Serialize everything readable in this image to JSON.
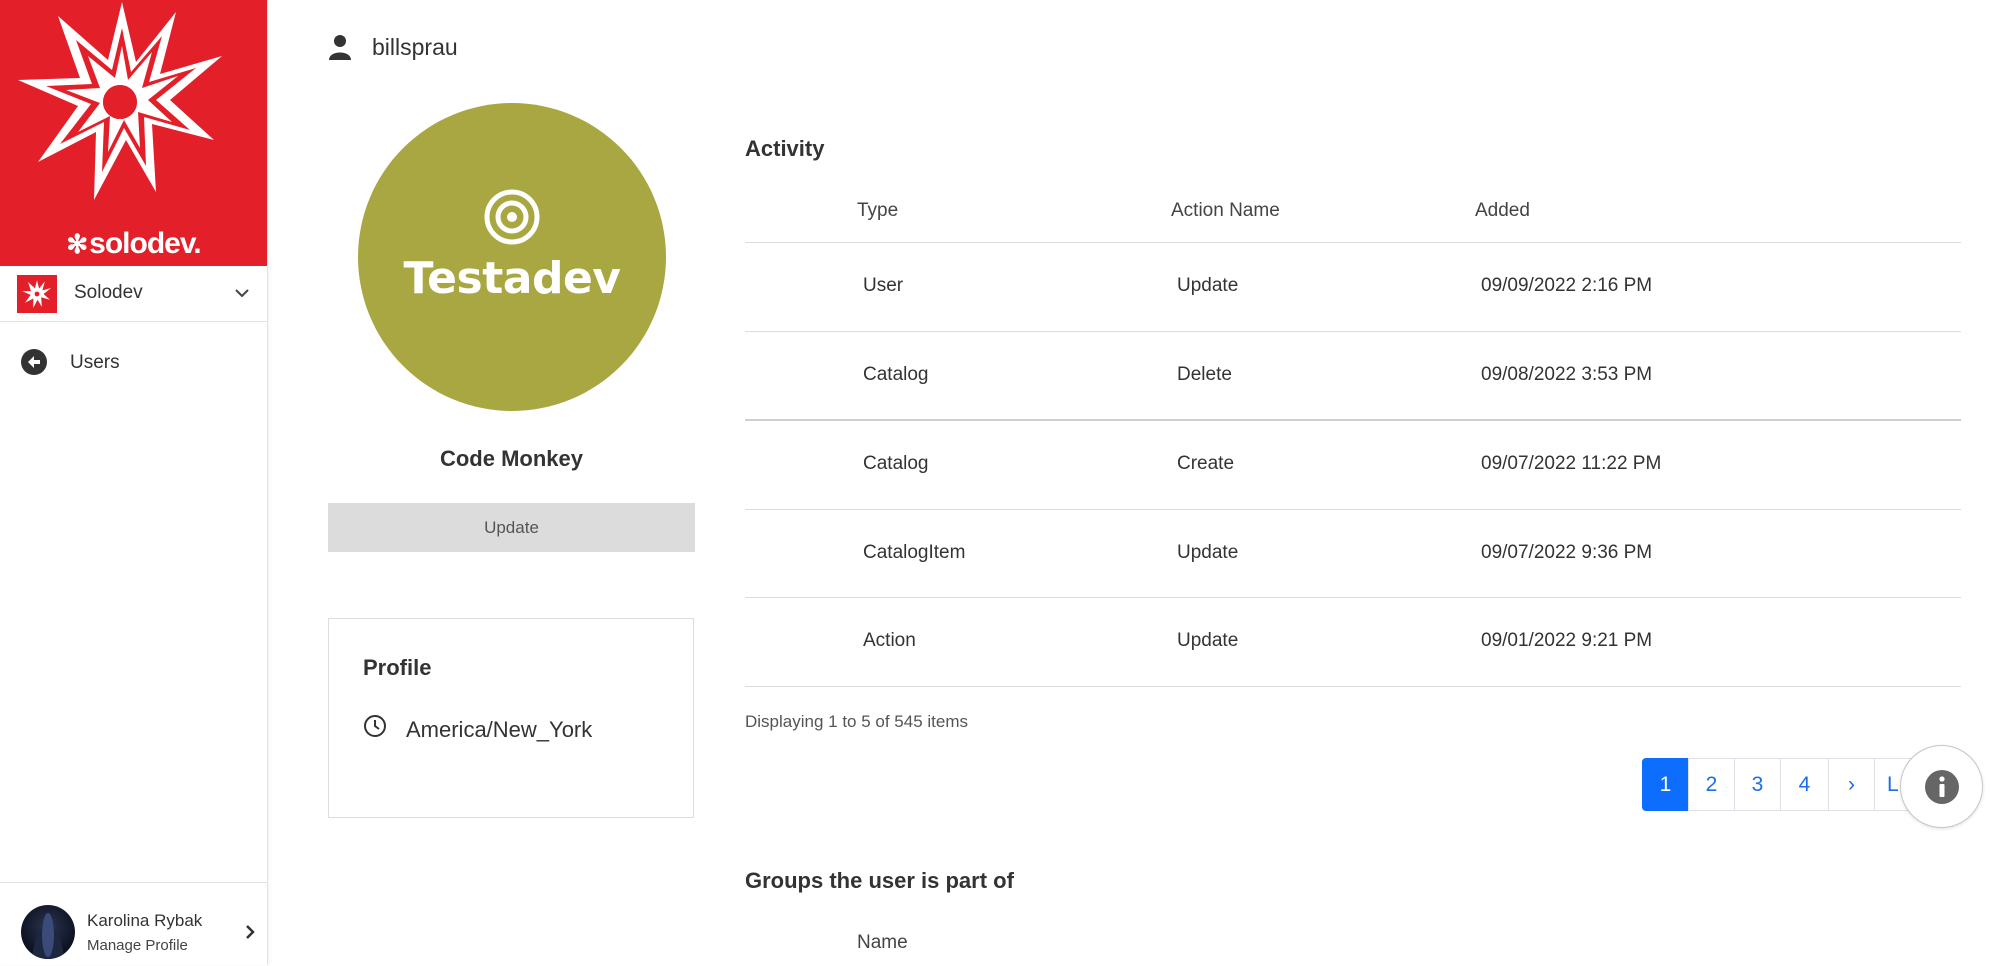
{
  "sidebar": {
    "brand_word": "solodev.",
    "site_selector": {
      "label": "Solodev"
    },
    "nav": {
      "users_label": "Users"
    },
    "footer": {
      "user_name": "Karolina Rybak",
      "manage_label": "Manage Profile"
    }
  },
  "header": {
    "username": "billsprau"
  },
  "profile_column": {
    "avatar_text": "Testadev",
    "display_name": "Code Monkey",
    "update_button": "Update",
    "profile_card": {
      "title": "Profile",
      "timezone": "America/New_York"
    }
  },
  "activity": {
    "title": "Activity",
    "columns": [
      "Type",
      "Action Name",
      "Added"
    ],
    "rows": [
      [
        "User",
        "Update",
        "09/09/2022 2:16 PM"
      ],
      [
        "Catalog",
        "Delete",
        "09/08/2022 3:53 PM"
      ],
      [
        "Catalog",
        "Create",
        "09/07/2022 11:22 PM"
      ],
      [
        "CatalogItem",
        "Update",
        "09/07/2022 9:36 PM"
      ],
      [
        "Action",
        "Update",
        "09/01/2022 9:21 PM"
      ]
    ],
    "display_info": "Displaying 1 to 5 of 545 items"
  },
  "pagination": {
    "pages": [
      "1",
      "2",
      "3",
      "4"
    ],
    "active_page": "1",
    "next_symbol": "›",
    "last_partial": "L"
  },
  "groups": {
    "title": "Groups the user is part of",
    "name_header": "Name"
  },
  "colors": {
    "brand_red": "#e3202a",
    "avatar_olive": "#a9a742",
    "pager_active": "#0d6efd",
    "pager_text": "#1a6fe8"
  },
  "icons": {
    "header": "user-icon",
    "nav_back": "arrow-left-circle-icon",
    "timezone": "clock-icon",
    "info": "info-circle-icon"
  }
}
